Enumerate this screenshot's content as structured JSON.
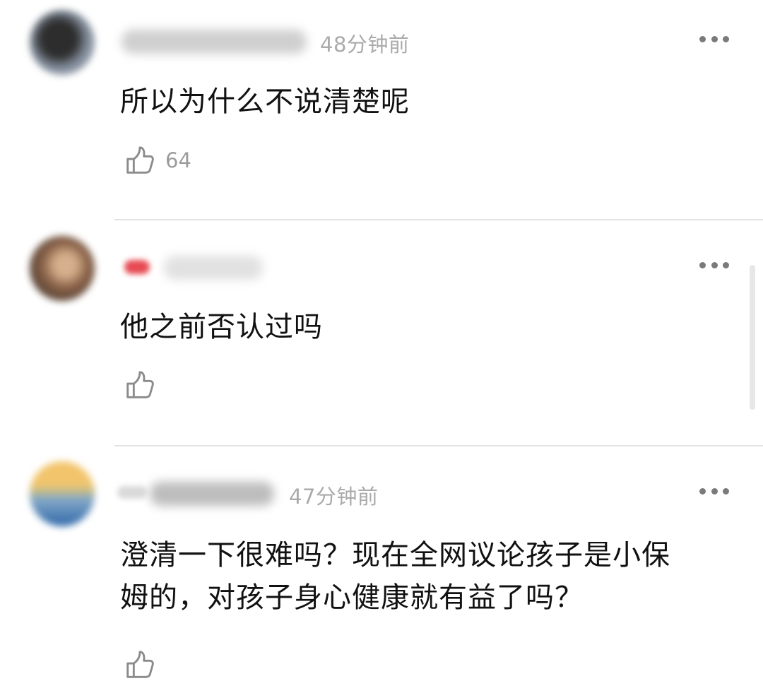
{
  "comments": [
    {
      "time": "48分钟前",
      "text": "所以为什么不说清楚呢",
      "likes": "64",
      "avatar_colors": [
        "#3a3a3a",
        "#a7b4c4"
      ],
      "name_color": "#c9c9c9"
    },
    {
      "time": "",
      "text": "他之前否认过吗",
      "likes": "",
      "avatar_colors": [
        "#6e5340",
        "#c4a182"
      ],
      "name_color": "#d9d9d9",
      "badge_color": "#e64a52"
    },
    {
      "time": "47分钟前",
      "text_line1": "澄清一下很难吗？现在全网议论孩子是小保",
      "text_line2": "姆的，对孩子身心健康就有益了吗？",
      "likes": "",
      "avatar_colors": [
        "#f1c56e",
        "#3d78b8"
      ],
      "name_color": "#b9b9b9"
    }
  ],
  "icons": {
    "like": "thumbs-up-icon",
    "more": "more-horizontal-icon"
  }
}
